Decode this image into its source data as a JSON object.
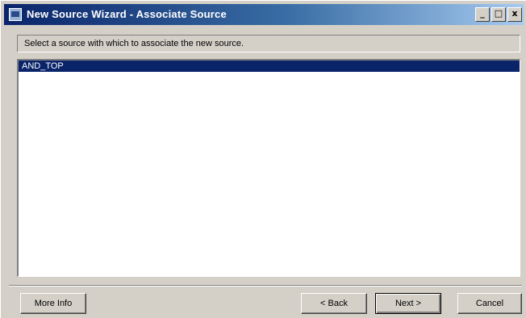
{
  "window": {
    "title": "New Source Wizard - Associate Source",
    "buttons": {
      "minimize": "_",
      "maximize": "□",
      "close": "x"
    }
  },
  "instruction": "Select a source with which to associate the new source.",
  "sources": [
    {
      "label": "AND_TOP",
      "selected": true
    }
  ],
  "buttons": {
    "more_info": "More Info",
    "back": "< Back",
    "next": "Next >",
    "cancel": "Cancel"
  },
  "colors": {
    "selection": "#0a246a",
    "title_start": "#0a246a",
    "title_end": "#a6caf0",
    "face": "#d4d0c8"
  }
}
